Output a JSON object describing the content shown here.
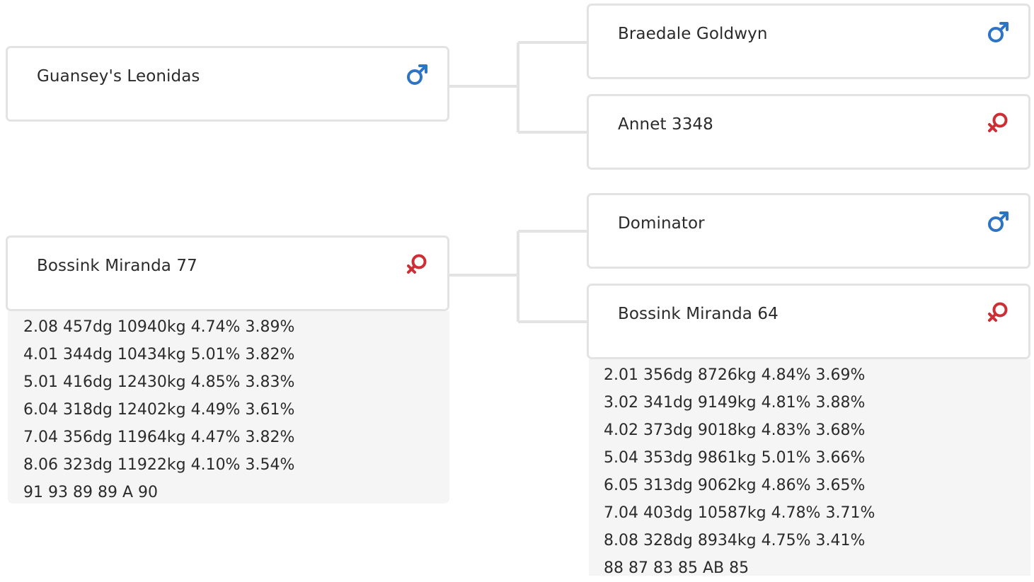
{
  "pedigree": {
    "sire": {
      "name": "Guansey's Leonidas",
      "sex": "male",
      "sire": {
        "name": "Braedale Goldwyn",
        "sex": "male"
      },
      "dam": {
        "name": "Annet 3348",
        "sex": "female"
      }
    },
    "dam": {
      "name": "Bossink Miranda 77",
      "sex": "female",
      "stats": [
        "2.08 457dg 10940kg 4.74% 3.89%",
        "4.01 344dg 10434kg 5.01% 3.82%",
        "5.01 416dg 12430kg 4.85% 3.83%",
        "6.04 318dg 12402kg 4.49% 3.61%",
        "7.04 356dg 11964kg 4.47% 3.82%",
        "8.06 323dg 11922kg 4.10% 3.54%",
        "91 93 89 89 A 90"
      ],
      "sire": {
        "name": "Dominator",
        "sex": "male"
      },
      "dam": {
        "name": "Bossink Miranda 64",
        "sex": "female",
        "stats": [
          "2.01 356dg 8726kg 4.84% 3.69%",
          "3.02 341dg 9149kg 4.81% 3.88%",
          "4.02 373dg 9018kg 4.83% 3.68%",
          "5.04 353dg 9861kg 5.01% 3.66%",
          "6.05 313dg 9062kg 4.86% 3.65%",
          "7.04 403dg 10587kg 4.78% 3.71%",
          "8.08 328dg 8934kg 4.75% 3.41%",
          "88 87 83 85 AB 85"
        ]
      }
    }
  },
  "colors": {
    "male": "#2f74c4",
    "female": "#cc2f35",
    "connector": "#e3e3e3"
  },
  "icons": {
    "male": "male-symbol-icon",
    "female": "female-symbol-icon"
  }
}
